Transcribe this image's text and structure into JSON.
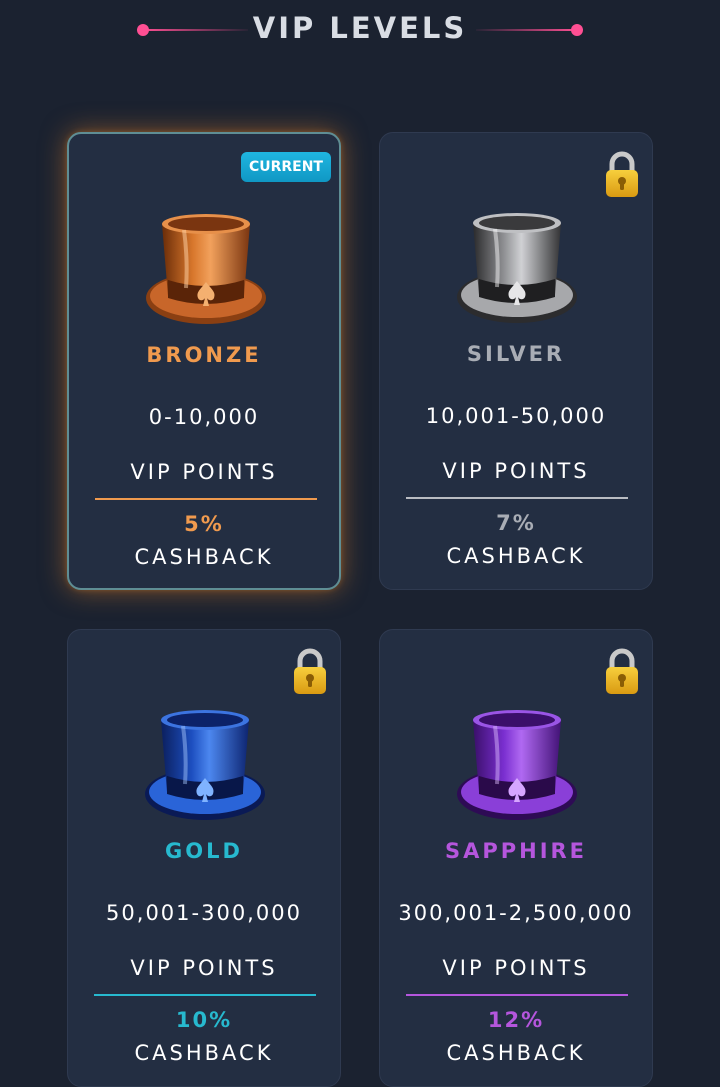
{
  "header": {
    "title": "VIP LEVELS",
    "accent_color": "#ff4f93"
  },
  "tiers": [
    {
      "name": "BRONZE",
      "range": "0-10,000",
      "points_label": "VIP POINTS",
      "cashback_pct": "5%",
      "cashback_label": "CASHBACK",
      "color": "#f09a4e",
      "status": "current",
      "badge": "CURRENT",
      "icon": "bronze-top-hat-icon"
    },
    {
      "name": "SILVER",
      "range": "10,001-50,000",
      "points_label": "VIP POINTS",
      "cashback_pct": "7%",
      "cashback_label": "CASHBACK",
      "color": "#a9adb5",
      "status": "locked",
      "icon": "silver-top-hat-icon"
    },
    {
      "name": "GOLD",
      "range": "50,001-300,000",
      "points_label": "VIP POINTS",
      "cashback_pct": "10%",
      "cashback_label": "CASHBACK",
      "color": "#27b9cf",
      "status": "locked",
      "icon": "blue-top-hat-icon"
    },
    {
      "name": "SAPPHIRE",
      "range": "300,001-2,500,000",
      "points_label": "VIP POINTS",
      "cashback_pct": "12%",
      "cashback_label": "CASHBACK",
      "color": "#b556dd",
      "status": "locked",
      "icon": "purple-top-hat-icon"
    }
  ]
}
